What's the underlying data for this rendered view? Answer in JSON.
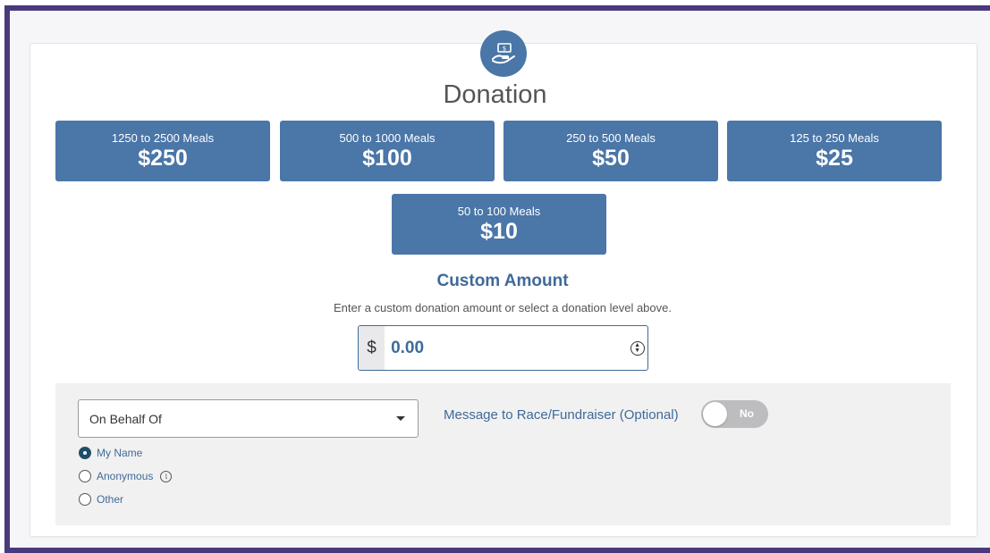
{
  "heading": "Donation",
  "levels": [
    {
      "meals": "1250 to 2500 Meals",
      "amount": "$250"
    },
    {
      "meals": "500 to 1000 Meals",
      "amount": "$100"
    },
    {
      "meals": "250 to 500 Meals",
      "amount": "$50"
    },
    {
      "meals": "125 to 250 Meals",
      "amount": "$25"
    },
    {
      "meals": "50 to 100 Meals",
      "amount": "$10"
    }
  ],
  "custom": {
    "heading": "Custom Amount",
    "help": "Enter a custom donation amount or select a donation level above.",
    "currency": "$",
    "value": "0.00"
  },
  "behalf": {
    "select_value": "On Behalf Of",
    "options": [
      {
        "label": "My Name",
        "checked": true
      },
      {
        "label": "Anonymous",
        "checked": false
      },
      {
        "label": "Other",
        "checked": false
      }
    ]
  },
  "message": {
    "label": "Message to Race/Fundraiser (Optional)",
    "toggle_text": "No"
  },
  "colors": {
    "frame": "#4a3a7c",
    "accent": "#4a76a8",
    "heading_blue": "#3f6a98"
  },
  "icons": [
    "hand-money-icon",
    "chevron-down-icon",
    "info-icon",
    "spinner-icon"
  ]
}
